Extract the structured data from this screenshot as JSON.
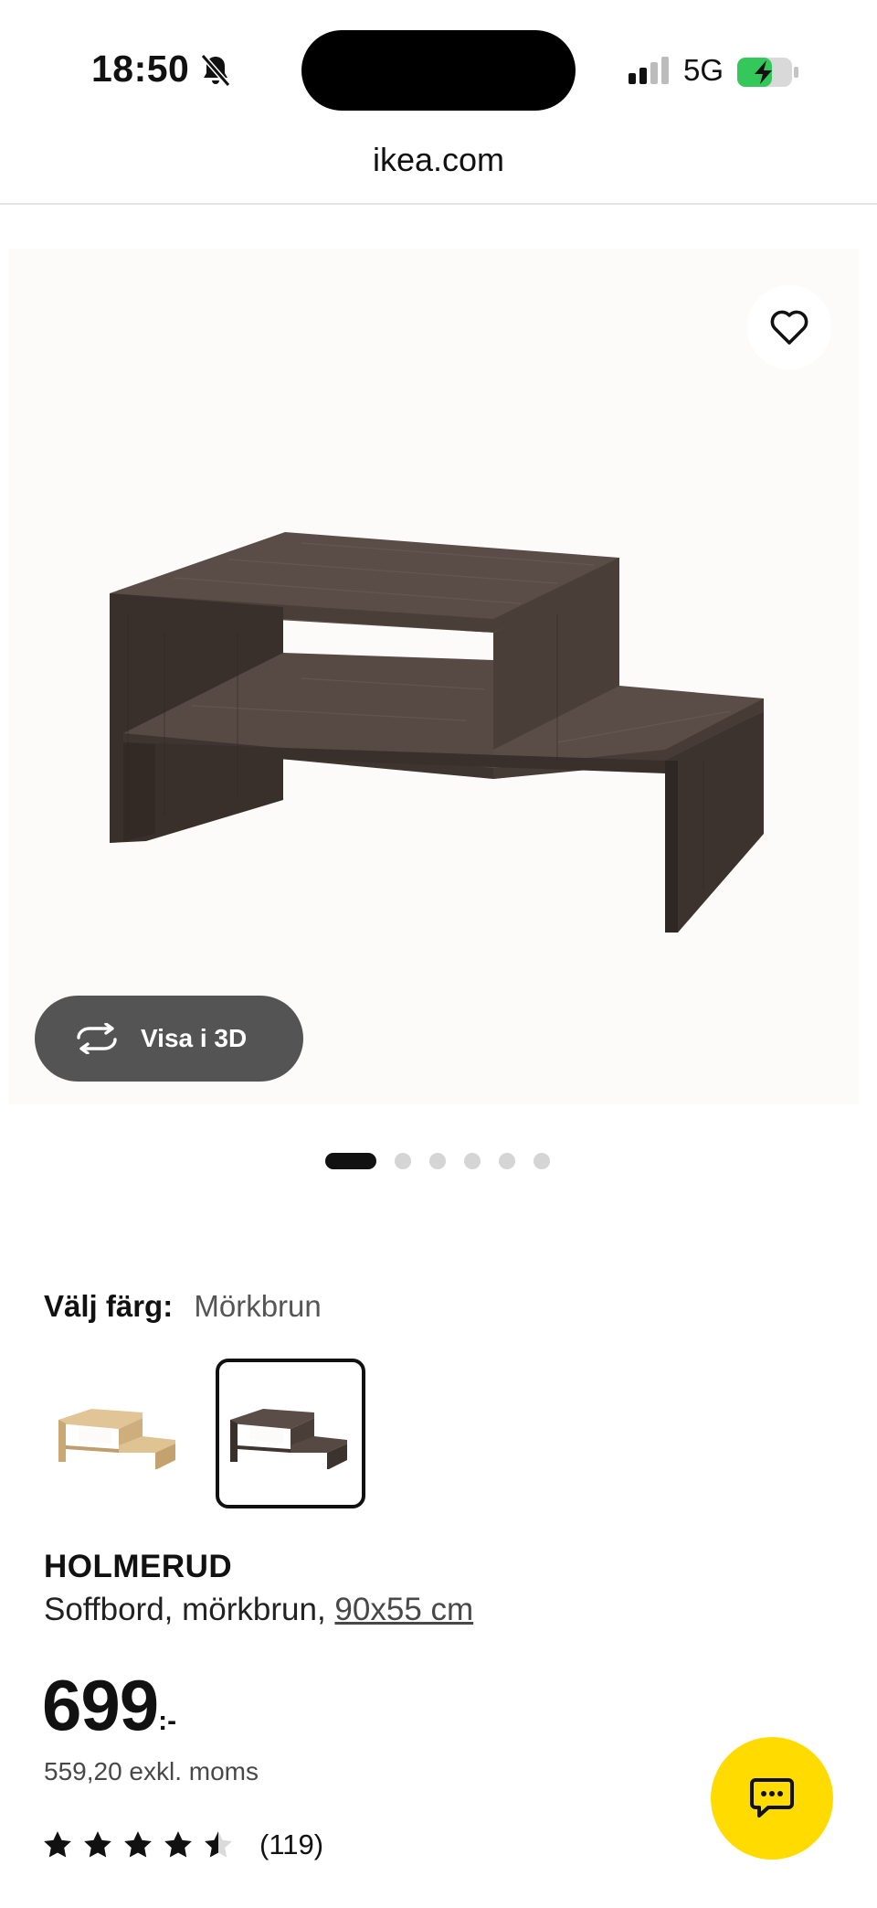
{
  "status_bar": {
    "time": "18:50",
    "network": "5G",
    "icons": [
      "bell-muted-icon",
      "signal-icon",
      "battery-charging-icon"
    ]
  },
  "browser": {
    "url": "ikea.com"
  },
  "media": {
    "view_3d_label": "Visa i 3D",
    "carousel_total": 6,
    "carousel_active": 1,
    "icons": [
      "heart-icon",
      "rotate-3d-icon"
    ]
  },
  "color": {
    "label": "Välj färg:",
    "selected": "Mörkbrun"
  },
  "product": {
    "name": "HOLMERUD",
    "description": "Soffbord, mörkbrun,",
    "size": "90x55 cm",
    "price_integer": "699",
    "price_suffix": ":-",
    "price_ex_vat": "559,20 exkl. moms",
    "rating": 4.5,
    "rating_max": 5,
    "review_count": "(119)"
  },
  "colors": {
    "accent": "#ffdb00",
    "button_dark": "#545454",
    "wood_dark": "#4a3e38",
    "wood_light": "#d9b98a"
  }
}
